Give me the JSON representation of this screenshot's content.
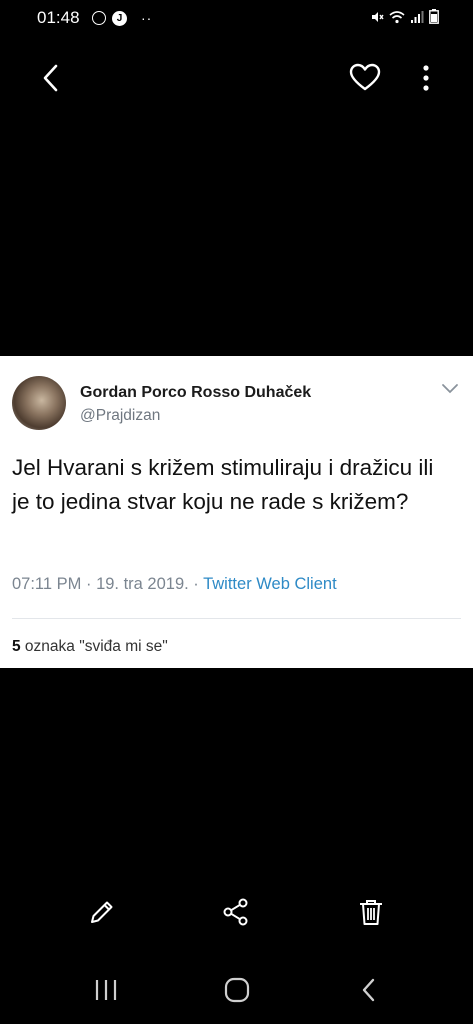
{
  "status": {
    "time": "01:48",
    "notification_icons": [
      "sync-icon",
      "j-app-icon",
      "more-notifications-icon"
    ],
    "system_icons": [
      "mute-icon",
      "wifi-icon",
      "signal-icon",
      "battery-icon"
    ]
  },
  "top_bar": {
    "back_icon": "back-arrow-icon",
    "favorite_icon": "heart-icon",
    "more_icon": "more-vertical-icon"
  },
  "tweet": {
    "author_name": "Gordan Porco Rosso Duhaček",
    "handle": "@Prajdizan",
    "text": "Jel Hvarani s križem stimuliraju i dražicu ili je to jedina stvar koju ne rade s križem?",
    "timestamp": "07:11 PM · 19. tra 2019. · ",
    "client": "Twitter Web Client",
    "like_count": "5",
    "like_label": " oznaka \"sviđa mi se\""
  },
  "bottom_actions": [
    "edit-icon",
    "share-icon",
    "delete-icon"
  ],
  "nav_bar": [
    "recent-apps-icon",
    "home-icon",
    "back-icon"
  ]
}
